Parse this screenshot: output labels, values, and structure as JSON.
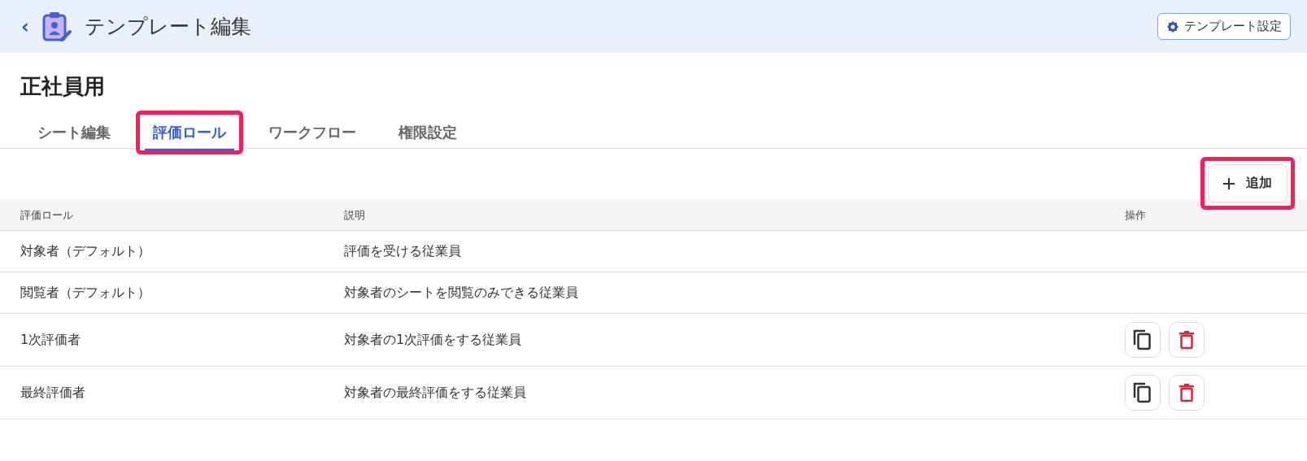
{
  "header": {
    "back": "‹",
    "title": "テンプレート編集",
    "settings_button": "テンプレート設定"
  },
  "page_title": "正社員用",
  "tabs": [
    {
      "label": "シート編集",
      "selected": false,
      "highlighted": false
    },
    {
      "label": "評価ロール",
      "selected": true,
      "highlighted": true
    },
    {
      "label": "ワークフロー",
      "selected": false,
      "highlighted": false
    },
    {
      "label": "権限設定",
      "selected": false,
      "highlighted": false
    }
  ],
  "add_button": {
    "label": "追加",
    "highlighted": true
  },
  "table": {
    "columns": [
      "評価ロール",
      "説明",
      "操作"
    ],
    "rows": [
      {
        "role": "対象者（デフォルト）",
        "description": "評価を受ける従業員",
        "actions": false
      },
      {
        "role": "閲覧者（デフォルト）",
        "description": "対象者のシートを閲覧のみできる従業員",
        "actions": false
      },
      {
        "role": "1次評価者",
        "description": "対象者の1次評価をする従業員",
        "actions": true
      },
      {
        "role": "最終評価者",
        "description": "対象者の最終評価をする従業員",
        "actions": true
      }
    ]
  }
}
